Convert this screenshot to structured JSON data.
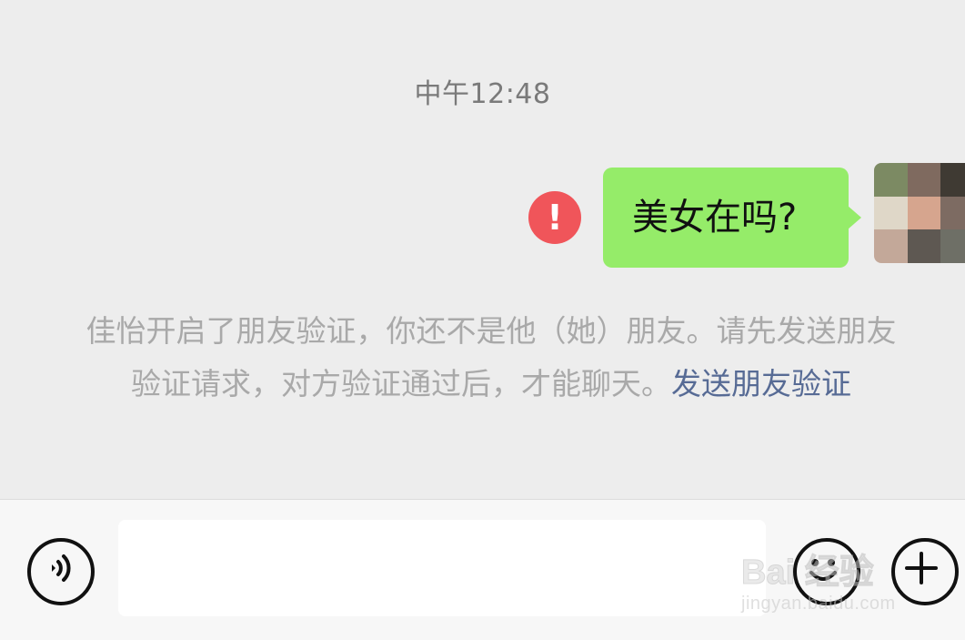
{
  "chat": {
    "timestamp": "中午12:48",
    "messages": [
      {
        "direction": "outgoing",
        "text": "美女在吗?",
        "status": "failed",
        "status_icon": "!",
        "bubble_color": "#95ec69"
      }
    ],
    "system_notice": {
      "text": "佳怡开启了朋友验证，你还不是他（她）朋友。请先发送朋友验证请求，对方验证通过后，才能聊天。",
      "link_text": "发送朋友验证",
      "link_color": "#576b95"
    }
  },
  "input_bar": {
    "voice_icon": "voice-icon",
    "text_value": "",
    "emoji_icon": "emoji-icon",
    "more_icon": "plus-icon"
  },
  "watermark": {
    "top": "Bai 经验",
    "bottom": "jingyan.baidu.com"
  },
  "colors": {
    "background": "#ededed",
    "error_badge": "#f0555a",
    "input_bar": "#f7f7f7"
  }
}
